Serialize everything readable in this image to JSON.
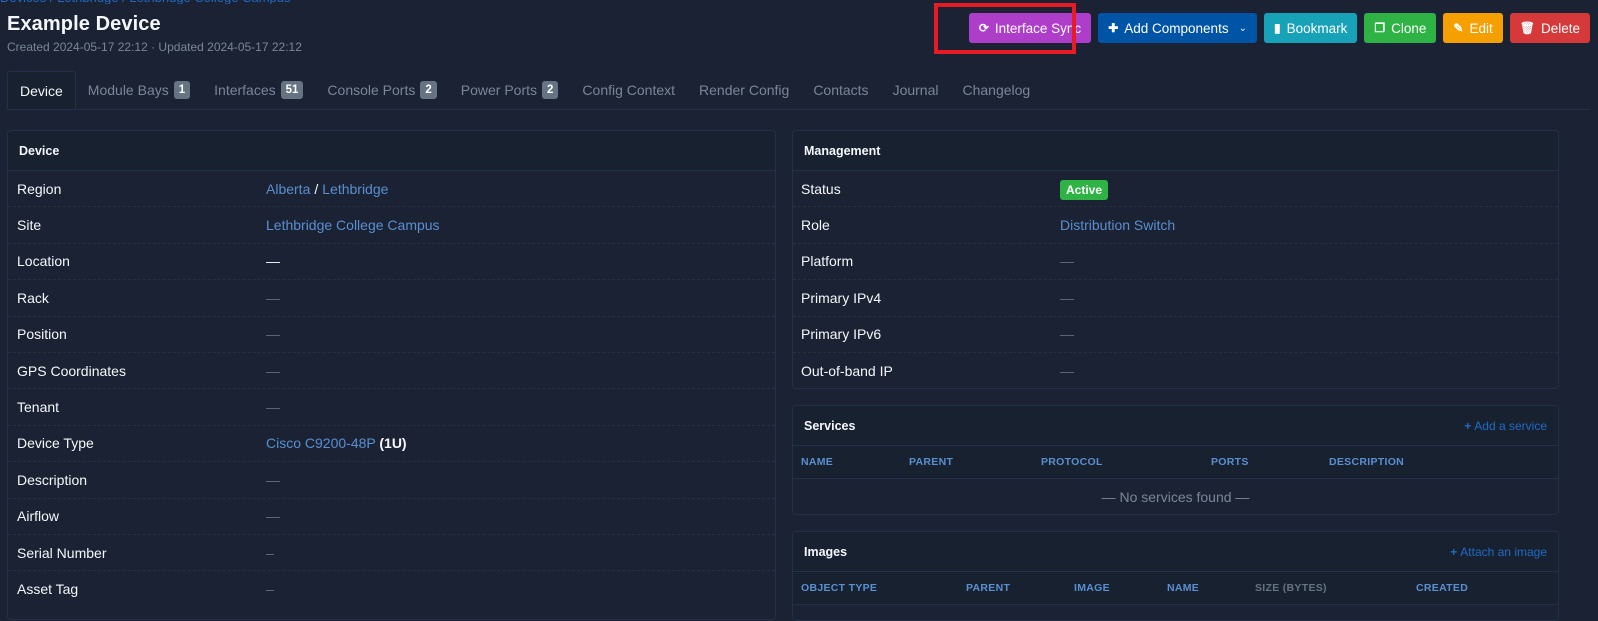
{
  "breadcrumb": {
    "partial_text": "Devices / Lethbridge / Lethbridge College Campus"
  },
  "header": {
    "title": "Example Device",
    "meta": "Created 2024-05-17 22:12 · Updated 2024-05-17 22:12"
  },
  "actions": {
    "interface_sync": {
      "label": "Interface Sync",
      "icon": "sync-icon"
    },
    "add_components": {
      "label": "Add Components",
      "icon": "plus-icon"
    },
    "bookmark": {
      "label": "Bookmark",
      "icon": "bookmark-icon"
    },
    "clone": {
      "label": "Clone",
      "icon": "clone-icon"
    },
    "edit": {
      "label": "Edit",
      "icon": "pencil-icon"
    },
    "delete": {
      "label": "Delete",
      "icon": "trash-icon"
    }
  },
  "tabs": [
    {
      "label": "Device",
      "active": true
    },
    {
      "label": "Module Bays",
      "count": "1"
    },
    {
      "label": "Interfaces",
      "count": "51"
    },
    {
      "label": "Console Ports",
      "count": "2"
    },
    {
      "label": "Power Ports",
      "count": "2"
    },
    {
      "label": "Config Context"
    },
    {
      "label": "Render Config"
    },
    {
      "label": "Contacts"
    },
    {
      "label": "Journal"
    },
    {
      "label": "Changelog"
    }
  ],
  "device_card": {
    "title": "Device",
    "rows": {
      "region": {
        "label": "Region",
        "value_parent": "Alberta",
        "separator": "/",
        "value_child": "Lethbridge"
      },
      "site": {
        "label": "Site",
        "value": "Lethbridge College Campus"
      },
      "location": {
        "label": "Location",
        "value": "—"
      },
      "rack": {
        "label": "Rack",
        "value": "—"
      },
      "position": {
        "label": "Position",
        "value": "—"
      },
      "gps": {
        "label": "GPS Coordinates",
        "value": "—"
      },
      "tenant": {
        "label": "Tenant",
        "value": "—"
      },
      "device_type": {
        "label": "Device Type",
        "value": "Cisco C9200-48P",
        "suffix": "(1U)"
      },
      "description": {
        "label": "Description",
        "value": "—"
      },
      "airflow": {
        "label": "Airflow",
        "value": "—"
      },
      "serial": {
        "label": "Serial Number",
        "value": "–"
      },
      "asset_tag": {
        "label": "Asset Tag",
        "value": "–"
      }
    }
  },
  "management_card": {
    "title": "Management",
    "rows": {
      "status": {
        "label": "Status",
        "value": "Active",
        "color": "#2fb344"
      },
      "role": {
        "label": "Role",
        "value": "Distribution Switch"
      },
      "platform": {
        "label": "Platform",
        "value": "—"
      },
      "ipv4": {
        "label": "Primary IPv4",
        "value": "—"
      },
      "ipv6": {
        "label": "Primary IPv6",
        "value": "—"
      },
      "oob": {
        "label": "Out-of-band IP",
        "value": "—"
      }
    }
  },
  "services_card": {
    "title": "Services",
    "add_link": "Add a service",
    "columns": [
      "NAME",
      "PARENT",
      "PROTOCOL",
      "PORTS",
      "DESCRIPTION"
    ],
    "empty_text": "— No services found —"
  },
  "images_card": {
    "title": "Images",
    "add_link": "Attach an image",
    "columns": [
      "OBJECT TYPE",
      "PARENT",
      "IMAGE",
      "NAME",
      "SIZE (BYTES)",
      "CREATED"
    ]
  }
}
